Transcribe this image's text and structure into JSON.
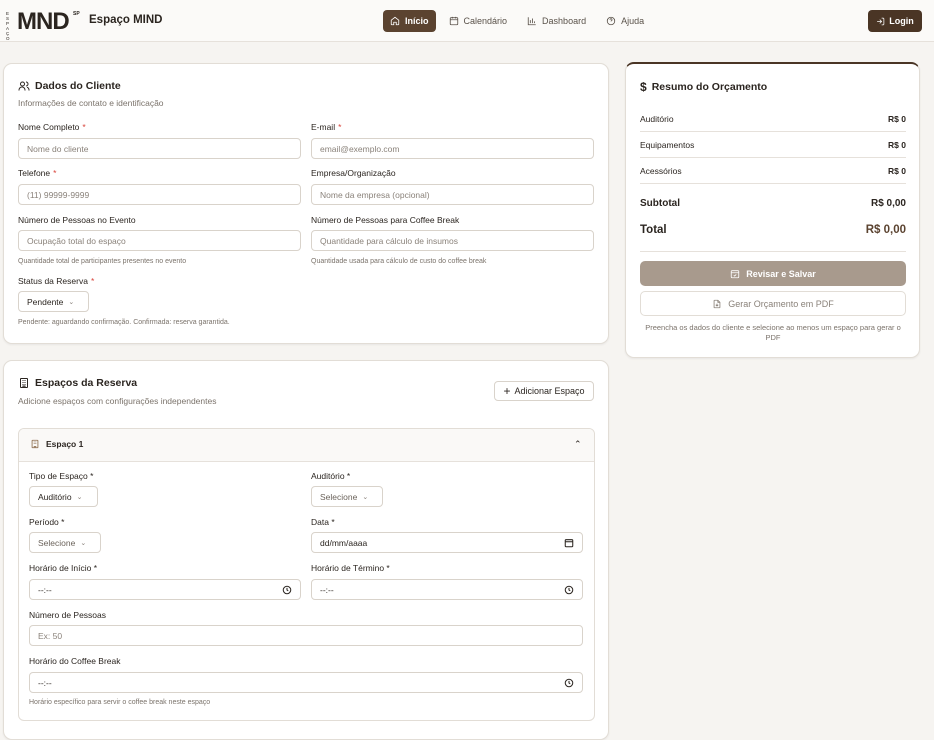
{
  "header": {
    "logo_letters": [
      "E",
      "S",
      "P",
      "A",
      "Ç",
      "O"
    ],
    "logo_word": "MND",
    "logo_sup": "SP",
    "brand": "Espaço MIND",
    "nav": [
      {
        "label": "Início",
        "icon": "home-icon"
      },
      {
        "label": "Calendário",
        "icon": "calendar-icon"
      },
      {
        "label": "Dashboard",
        "icon": "bar-chart-icon"
      },
      {
        "label": "Ajuda",
        "icon": "help-circle-icon"
      }
    ],
    "login_label": "Login"
  },
  "client": {
    "title": "Dados do Cliente",
    "subtitle": "Informações de contato e identificação",
    "name_label": "Nome Completo",
    "name_placeholder": "Nome do cliente",
    "email_label": "E-mail",
    "email_placeholder": "email@exemplo.com",
    "phone_label": "Telefone",
    "phone_placeholder": "(11) 99999-9999",
    "company_label": "Empresa/Organização",
    "company_placeholder": "Nome da empresa (opcional)",
    "people_label": "Número de Pessoas no Evento",
    "people_placeholder": "Ocupação total do espaço",
    "people_hint": "Quantidade total de participantes presentes no evento",
    "coffee_label": "Número de Pessoas para Coffee Break",
    "coffee_placeholder": "Quantidade para cálculo de insumos",
    "coffee_hint": "Quantidade usada para cálculo de custo do coffee break",
    "status_label": "Status da Reserva",
    "status_value": "Pendente",
    "status_hint": "Pendente: aguardando confirmação. Confirmada: reserva garantida.",
    "required_mark": "*"
  },
  "spaces": {
    "title": "Espaços da Reserva",
    "subtitle": "Adicione espaços com configurações independentes",
    "add_label": "Adicionar Espaço",
    "space_title": "Espaço 1",
    "type_label": "Tipo de Espaço *",
    "type_value": "Auditório",
    "auditorium_label": "Auditório *",
    "auditorium_value": "Selecione",
    "period_label": "Período *",
    "period_value": "Selecione",
    "date_label": "Data *",
    "date_value": "dd/mm/aaaa",
    "start_label": "Horário de Início *",
    "start_value": "--:--",
    "end_label": "Horário de Término *",
    "end_value": "--:--",
    "people_label": "Número de Pessoas",
    "people_placeholder": "Ex: 50",
    "coffee_time_label": "Horário do Coffee Break",
    "coffee_time_value": "--:--",
    "coffee_time_hint": "Horário específico para servir o coffee break neste espaço"
  },
  "summary": {
    "title": "Resumo do Orçamento",
    "rows": [
      {
        "label": "Auditório",
        "value": "R$ 0"
      },
      {
        "label": "Equipamentos",
        "value": "R$ 0"
      },
      {
        "label": "Acessórios",
        "value": "R$ 0"
      }
    ],
    "subtotal_label": "Subtotal",
    "subtotal_value": "R$ 0,00",
    "total_label": "Total",
    "total_value": "R$ 0,00",
    "review_label": "Revisar e Salvar",
    "pdf_label": "Gerar Orçamento em PDF",
    "note": "Preencha os dados do cliente e selecione ao menos um espaço para gerar o PDF"
  },
  "colors": {
    "accent": "#5b4330",
    "login": "#4a3525",
    "required": "#d9443b",
    "review_disabled": "#a89a8d"
  }
}
